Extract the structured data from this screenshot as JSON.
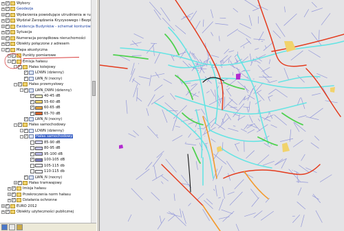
{
  "tree": [
    {
      "label": "Wybory",
      "indent": 0,
      "twisty": "+",
      "checked": true,
      "icon": "folder"
    },
    {
      "label": "Geodezja",
      "indent": 0,
      "twisty": "+",
      "checked": true,
      "icon": "folder",
      "blue": true
    },
    {
      "label": "Wydarzenia powodujące utrudnienia w ruchu",
      "indent": 0,
      "twisty": "+",
      "checked": true,
      "icon": "folder"
    },
    {
      "label": "Wydział Zarządzania Kryzysowego i Bezpieczeństw",
      "indent": 0,
      "twisty": "+",
      "checked": true,
      "icon": "folder"
    },
    {
      "label": "Ewidencja Budynków - schemat konturów budynk",
      "indent": 0,
      "twisty": "+",
      "checked": true,
      "icon": "folder",
      "blue": true
    },
    {
      "label": "Sytuacja",
      "indent": 0,
      "twisty": "+",
      "checked": true,
      "icon": "folder"
    },
    {
      "label": "Numeracja porządkowa nieruchomości",
      "indent": 0,
      "twisty": "+",
      "checked": true,
      "icon": "folder"
    },
    {
      "label": "Obiekty połączone z adresem",
      "indent": 0,
      "twisty": "+",
      "checked": true,
      "icon": "folder"
    },
    {
      "label": "Mapa akustyczna",
      "indent": 0,
      "twisty": "-",
      "checked": true,
      "icon": "folder"
    },
    {
      "label": "Punkty pomiarowe",
      "indent": 1,
      "twisty": "+",
      "checked": true,
      "icon": "folder"
    },
    {
      "label": "Emisja hałasu",
      "indent": 1,
      "twisty": "-",
      "checked": true,
      "icon": "folder"
    },
    {
      "label": "Hałas kolejowy",
      "indent": 2,
      "twisty": "-",
      "checked": true,
      "icon": "folder"
    },
    {
      "label": "LDWN (dzienny)",
      "indent": 3,
      "twisty": "",
      "checked": true,
      "icon": "layer"
    },
    {
      "label": "LWN_N (nocny)",
      "indent": 3,
      "twisty": "",
      "checked": true,
      "icon": "layer"
    },
    {
      "label": "Hałas przemysłowy",
      "indent": 2,
      "twisty": "-",
      "checked": true,
      "icon": "folder"
    },
    {
      "label": "LWN_DWN (dzienny)",
      "indent": 3,
      "twisty": "-",
      "checked": true,
      "icon": "layer"
    },
    {
      "label": "40-45 dB",
      "indent": 4,
      "twisty": "",
      "checked": true,
      "icon": "sym",
      "color": "#f6f6c0"
    },
    {
      "label": "55-60 dB",
      "indent": 4,
      "twisty": "",
      "checked": true,
      "icon": "sym",
      "color": "#f2d36a"
    },
    {
      "label": "60-65 dB",
      "indent": 4,
      "twisty": "",
      "checked": true,
      "icon": "sym",
      "color": "#e6a23c"
    },
    {
      "label": "65-70 dB",
      "indent": 4,
      "twisty": "",
      "checked": true,
      "icon": "sym",
      "color": "#d8622a"
    },
    {
      "label": "LWN_N (nocny)",
      "indent": 3,
      "twisty": "",
      "checked": true,
      "icon": "layer"
    },
    {
      "label": "Hałas samochodowy",
      "indent": 2,
      "twisty": "-",
      "checked": true,
      "icon": "folder"
    },
    {
      "label": "LDWN (dzienny)",
      "indent": 3,
      "twisty": "-",
      "checked": true,
      "icon": "layer"
    },
    {
      "label": "Hałas samochodowy",
      "indent": 3,
      "twisty": "-",
      "checked": true,
      "icon": "layer",
      "selected": true
    },
    {
      "label": "85-90 dB",
      "indent": 4,
      "twisty": "",
      "checked": false,
      "icon": "sym",
      "color": "#d9d9ff"
    },
    {
      "label": "80-95 dB",
      "indent": 4,
      "twisty": "",
      "checked": false,
      "icon": "sym",
      "color": "#c3c3f2"
    },
    {
      "label": "95-100 dB",
      "indent": 4,
      "twisty": "",
      "checked": true,
      "icon": "sym",
      "color": "#b9b9ea"
    },
    {
      "label": "100-105 dB",
      "indent": 4,
      "twisty": "",
      "checked": true,
      "icon": "sym",
      "color": "#7e7ec2"
    },
    {
      "label": "105-115 db",
      "indent": 4,
      "twisty": "",
      "checked": false,
      "icon": "sym",
      "color": "#ececf6"
    },
    {
      "label": "110-115 db",
      "indent": 4,
      "twisty": "",
      "checked": false,
      "icon": "sym",
      "color": "#ececf6"
    },
    {
      "label": "LWN_N (nocny)",
      "indent": 3,
      "twisty": "",
      "checked": true,
      "icon": "layer"
    },
    {
      "label": "Hałas tramwajowy",
      "indent": 2,
      "twisty": "+",
      "checked": true,
      "icon": "folder"
    },
    {
      "label": "Imisja hałasu",
      "indent": 1,
      "twisty": "+",
      "checked": true,
      "icon": "folder"
    },
    {
      "label": "Przekroczenia norm hałasu",
      "indent": 1,
      "twisty": "+",
      "checked": true,
      "icon": "folder"
    },
    {
      "label": "Działania ochronne",
      "indent": 1,
      "twisty": "+",
      "checked": true,
      "icon": "folder"
    },
    {
      "label": "EURO 2012",
      "indent": 0,
      "twisty": "+",
      "checked": true,
      "icon": "folder"
    },
    {
      "label": "Obiekty użyteczności publicznej",
      "indent": 0,
      "twisty": "+",
      "checked": true,
      "icon": "folder"
    }
  ],
  "toolbar": {
    "icons": [
      "layers-icon",
      "print-icon",
      "settings-icon"
    ]
  },
  "map": {
    "colors": {
      "background": "#e4e4e6",
      "street": "#8a8fd8",
      "cyan": "#5fe4e4",
      "green": "#4ed14e",
      "red": "#e43a1c",
      "orange": "#f39a2c",
      "yellow": "#f1d36b",
      "purple": "#b22ad0",
      "black": "#111111"
    }
  }
}
